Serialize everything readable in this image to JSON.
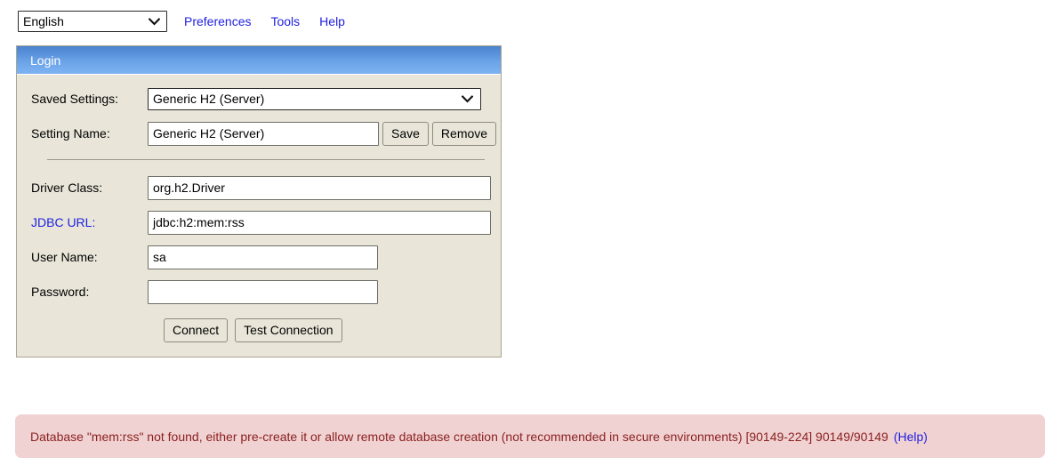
{
  "toolbar": {
    "language_select": {
      "value": "English",
      "icon": "chevron-down-icon"
    },
    "links": [
      {
        "label": "Preferences"
      },
      {
        "label": "Tools"
      },
      {
        "label": "Help"
      }
    ]
  },
  "login_panel": {
    "header_title": "Login",
    "rows": {
      "saved_settings": {
        "label": "Saved Settings:",
        "value": "Generic H2 (Server)",
        "icon": "chevron-down-icon"
      },
      "setting_name": {
        "label": "Setting Name:",
        "value": "Generic H2 (Server)",
        "save_label": "Save",
        "remove_label": "Remove"
      },
      "driver_class": {
        "label": "Driver Class:",
        "value": "org.h2.Driver"
      },
      "jdbc_url": {
        "label": "JDBC URL:",
        "value": "jdbc:h2:mem:rss"
      },
      "user_name": {
        "label": "User Name:",
        "value": "sa"
      },
      "password": {
        "label": "Password:",
        "value": ""
      }
    },
    "actions": {
      "connect_label": "Connect",
      "test_connection_label": "Test Connection"
    }
  },
  "error_banner": {
    "message": "Database \"mem:rss\" not found, either pre-create it or allow remote database creation (not recommended in secure environments) [90149-224] 90149/90149",
    "help_label": "(Help)"
  },
  "colors": {
    "panel_background": "#e9e6d9",
    "panel_border": "#a9a694",
    "header_blue_top": "#4a82cd",
    "header_blue_bottom": "#7db3f2",
    "link_blue": "#2121e0",
    "error_background": "#f0d2d2",
    "error_text": "#8c2121"
  }
}
